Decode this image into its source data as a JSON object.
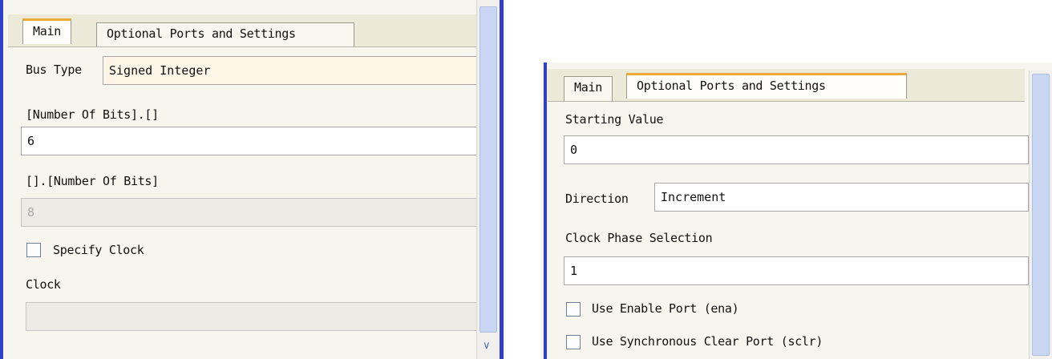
{
  "left_panel": {
    "tabs": [
      {
        "label": "Main",
        "active": true
      },
      {
        "label": "Optional Ports and Settings",
        "active": false
      }
    ],
    "bus_type": {
      "label": "Bus Type",
      "value": "Signed Integer"
    },
    "integer_bits": {
      "label": "[Number Of Bits].[]",
      "value": "6"
    },
    "fraction_bits": {
      "label": "[].[Number Of Bits]",
      "value": "8"
    },
    "specify_clock": {
      "label": "Specify Clock",
      "checked": false
    },
    "clock": {
      "label": "Clock",
      "value": ""
    }
  },
  "right_panel": {
    "tabs": [
      {
        "label": "Main",
        "active": false
      },
      {
        "label": "Optional Ports and Settings",
        "active": true
      }
    ],
    "starting_value": {
      "label": "Starting Value",
      "value": "0"
    },
    "direction": {
      "label": "Direction",
      "value": "Increment"
    },
    "clock_phase": {
      "label": "Clock Phase Selection",
      "value": "1"
    },
    "use_enable": {
      "label": "Use Enable Port (ena)",
      "checked": false
    },
    "use_sclr": {
      "label": "Use Synchronous Clear Port (sclr)",
      "checked": false
    }
  },
  "colors": {
    "active_tab_accent": "#f0a838",
    "frame_blue": "#2f3fc8"
  }
}
